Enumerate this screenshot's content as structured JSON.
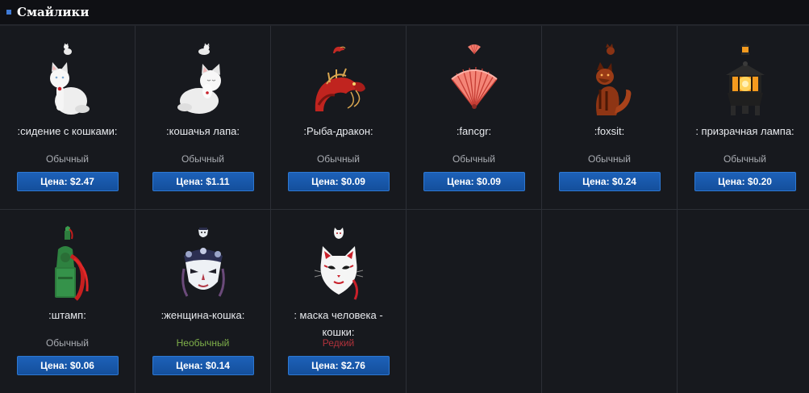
{
  "header": {
    "title": "Смайлики"
  },
  "items": [
    {
      "name": ":сидение с кошками:",
      "rarity": "Обычный",
      "price": "Цена: $2.47",
      "icon": "sitting-cat-icon"
    },
    {
      "name": ":кошачья лапа:",
      "rarity": "Обычный",
      "price": "Цена: $1.11",
      "icon": "cat-paw-icon"
    },
    {
      "name": ":Рыба-дракон:",
      "rarity": "Обычный",
      "price": "Цена: $0.09",
      "icon": "fish-dragon-icon"
    },
    {
      "name": ":fancgr:",
      "rarity": "Обычный",
      "price": "Цена: $0.09",
      "icon": "fan-icon"
    },
    {
      "name": ":foxsit:",
      "rarity": "Обычный",
      "price": "Цена: $0.24",
      "icon": "fox-icon"
    },
    {
      "name": ": призрачная лампа:",
      "rarity": "Обычный",
      "price": "Цена: $0.20",
      "icon": "ghost-lamp-icon"
    },
    {
      "name": ":штамп:",
      "rarity": "Обычный",
      "price": "Цена: $0.06",
      "icon": "stamp-icon"
    },
    {
      "name": ":женщина-кошка:",
      "rarity": "Необычный",
      "price": "Цена: $0.14",
      "icon": "cat-woman-mask-icon"
    },
    {
      "name": ": маска человека - кошки:",
      "rarity": "Редкий",
      "price": "Цена: $2.76",
      "icon": "cat-mask-icon"
    }
  ],
  "colors": {
    "accent": "#1a5fb4",
    "uncommon": "#7fb04a",
    "rare": "#b0323b",
    "common": "#a9acb2"
  }
}
